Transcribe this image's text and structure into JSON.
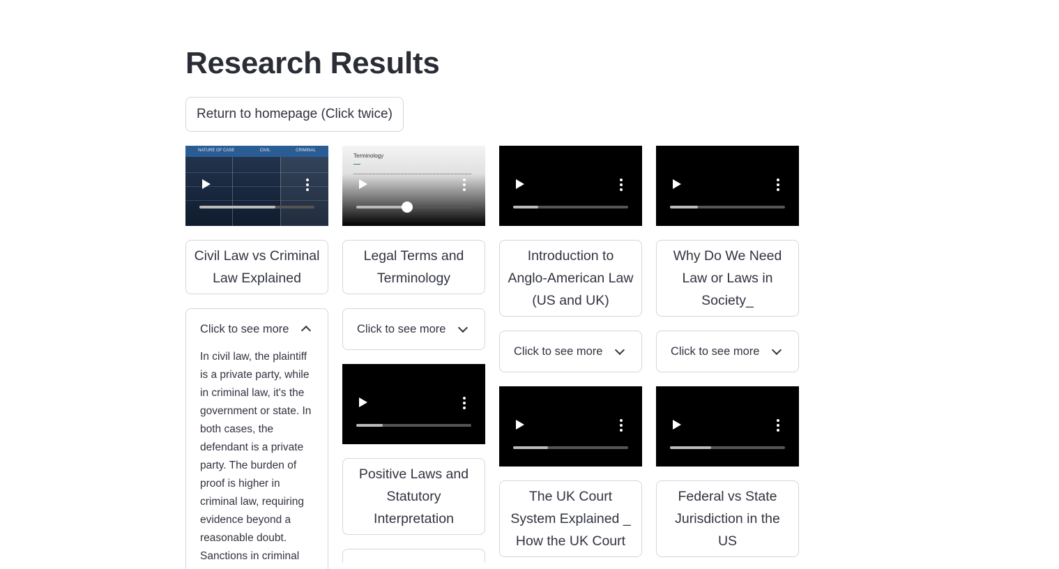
{
  "page": {
    "title": "Research Results",
    "home_button_label": "Return to homepage (Click twice)"
  },
  "expander_label": "Click to see more",
  "columns": [
    {
      "video1_progress": 0.66,
      "title1": "Civil Law vs Criminal Law Explained",
      "expander_open": true,
      "expander_text": "In civil law, the plaintiff is a private party, while in criminal law, it's the government or state. In both cases, the defendant is a private party. The burden of proof is higher in criminal law, requiring evidence beyond a reasonable doubt. Sanctions in criminal"
    },
    {
      "video1_progress": 0.44,
      "title1": "Legal Terms and Terminology",
      "video2_progress": 0.23,
      "title2": "Positive Laws and Statutory Interpretation"
    },
    {
      "video1_progress": 0.22,
      "title1": "Introduction to Anglo-American Law (US and UK)",
      "video2_progress": 0.3,
      "title2": "The UK Court System Explained _ How the UK Court"
    },
    {
      "video1_progress": 0.24,
      "title1": "Why Do We Need Law or Laws in Society_",
      "video2_progress": 0.36,
      "title2": "Federal vs State Jurisdiction in the US"
    }
  ],
  "thumbnails": {
    "table_headers": [
      "NATURE OF CASE",
      "CIVIL",
      "CRIMINAL"
    ],
    "terminology_title": "Terminology"
  }
}
